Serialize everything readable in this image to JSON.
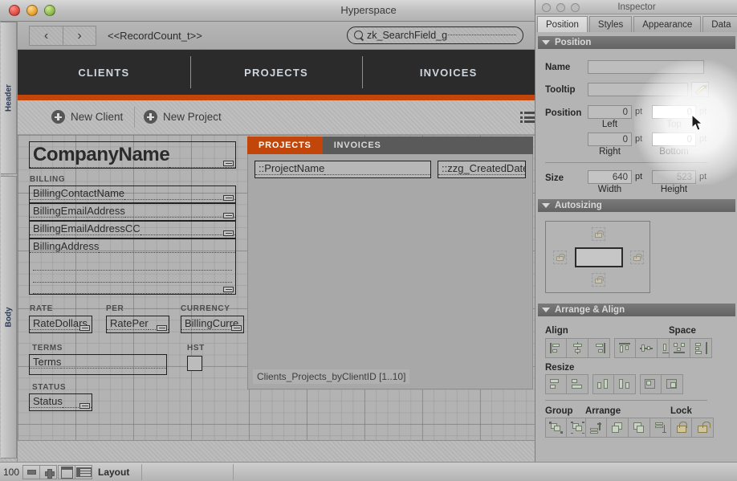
{
  "window": {
    "title": "Hyperspace",
    "traffic_lights": [
      "close-red",
      "minimize-yellow",
      "zoom-green"
    ]
  },
  "toolbar": {
    "back_label": "‹",
    "forward_label": "›",
    "record_count": "<<RecordCount_t>>",
    "search_value": "zk_SearchField_g",
    "search_icon": "magnifier-icon"
  },
  "navbar": {
    "tabs": [
      {
        "label": "CLIENTS"
      },
      {
        "label": "PROJECTS"
      },
      {
        "label": "INVOICES"
      }
    ],
    "accent_color": "#c2450a",
    "bar_color": "#2b2b2b"
  },
  "actions": {
    "new_client": "New Client",
    "new_project": "New Project",
    "list_icon": "list-view-icon"
  },
  "parts": {
    "header": "Header",
    "body": "Body"
  },
  "layout_fields": {
    "company_name": "CompanyName",
    "billing_label": "BILLING",
    "billing_contact": "BillingContactName",
    "billing_email": "BillingEmailAddress",
    "billing_email_cc": "BillingEmailAddressCC",
    "billing_address": "BillingAddress",
    "rate_label": "RATE",
    "per_label": "PER",
    "currency_label": "CURRENCY",
    "rate_dollars": "RateDollars",
    "rate_per": "RatePer",
    "billing_currency": "BillingCurre",
    "terms_label": "TERMS",
    "hst_label": "HST",
    "terms": "Terms",
    "status_label": "STATUS",
    "status": "Status"
  },
  "tab_control": {
    "tabs": [
      {
        "label": "PROJECTS",
        "active": true
      },
      {
        "label": "INVOICES",
        "active": false
      }
    ],
    "project_name_field": "::ProjectName",
    "created_date_field": "::zzg_CreatedDate",
    "portal_label": "Clients_Projects_byClientID [1..10]"
  },
  "statusbar": {
    "zoom": "100",
    "zoom_out_icon": "zoom-out-icon",
    "zoom_in_icon": "zoom-in-icon",
    "view_form_icon": "form-view-icon",
    "view_table_icon": "table-view-icon",
    "mode_label": "Layout"
  },
  "inspector": {
    "title": "Inspector",
    "tabs": [
      {
        "label": "Position",
        "active": true
      },
      {
        "label": "Styles",
        "active": false
      },
      {
        "label": "Appearance",
        "active": false
      },
      {
        "label": "Data",
        "active": false
      }
    ],
    "position_section": {
      "header": "Position",
      "name_label": "Name",
      "name_value": "",
      "tooltip_label": "Tooltip",
      "tooltip_value": "",
      "tooltip_edit_icon": "pencil-icon",
      "position_label": "Position",
      "left_value": "0",
      "left_label": "Left",
      "top_value": "0",
      "top_label": "Top",
      "right_value": "0",
      "right_label": "Right",
      "bottom_value": "0",
      "bottom_label": "Bottom",
      "unit": "pt",
      "size_label": "Size",
      "width_value": "640",
      "width_label": "Width",
      "height_value": "523",
      "height_label": "Height"
    },
    "autosizing_section": {
      "header": "Autosizing",
      "anchors": [
        "lock-top-icon",
        "lock-left-icon",
        "lock-right-icon",
        "lock-bottom-icon"
      ]
    },
    "arrange_section": {
      "header": "Arrange & Align",
      "align_label": "Align",
      "align_buttons": [
        "align-left-icon",
        "align-center-vertical-icon",
        "align-right-icon",
        "align-top-icon",
        "align-middle-horizontal-icon",
        "align-bottom-icon"
      ],
      "space_label": "Space",
      "space_buttons": [
        "distribute-horizontal-icon",
        "distribute-vertical-icon"
      ],
      "resize_label": "Resize",
      "resize_buttons": [
        "resize-smallest-width-icon",
        "resize-largest-width-icon",
        "resize-smallest-height-icon",
        "resize-largest-height-icon",
        "resize-smallest-both-icon",
        "resize-largest-both-icon"
      ],
      "group_label": "Group",
      "group_buttons": [
        "group-icon",
        "ungroup-icon"
      ],
      "arrange_label": "Arrange",
      "arrange_buttons": [
        "bring-to-front-icon",
        "bring-forward-icon",
        "send-backward-icon",
        "send-to-back-icon"
      ],
      "lock_label": "Lock",
      "lock_buttons": [
        "lock-closed-icon",
        "lock-open-icon"
      ]
    }
  },
  "cursor": {
    "icon": "arrow-pointer-icon"
  }
}
